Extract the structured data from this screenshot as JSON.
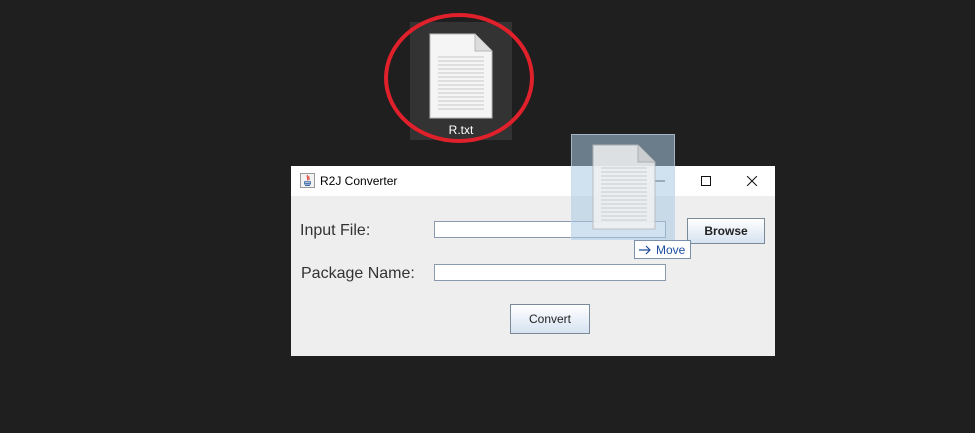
{
  "desktop": {
    "file_icon": {
      "icon": "text-file-icon",
      "label": "R.txt"
    },
    "highlight_color": "#e0202a"
  },
  "window": {
    "title": "R2J Converter",
    "app_icon": "java-icon",
    "controls": {
      "minimize_icon": "minimize-icon",
      "maximize_icon": "maximize-icon",
      "close_icon": "close-icon"
    },
    "form": {
      "input_file_label": "Input File:",
      "input_file_value": "",
      "package_name_label": "Package Name:",
      "package_name_value": "",
      "browse_label": "Browse",
      "convert_label": "Convert"
    }
  },
  "drag": {
    "ghost_icon": "text-file-icon",
    "tooltip_icon": "arrow-right-icon",
    "tooltip_label": "Move"
  }
}
